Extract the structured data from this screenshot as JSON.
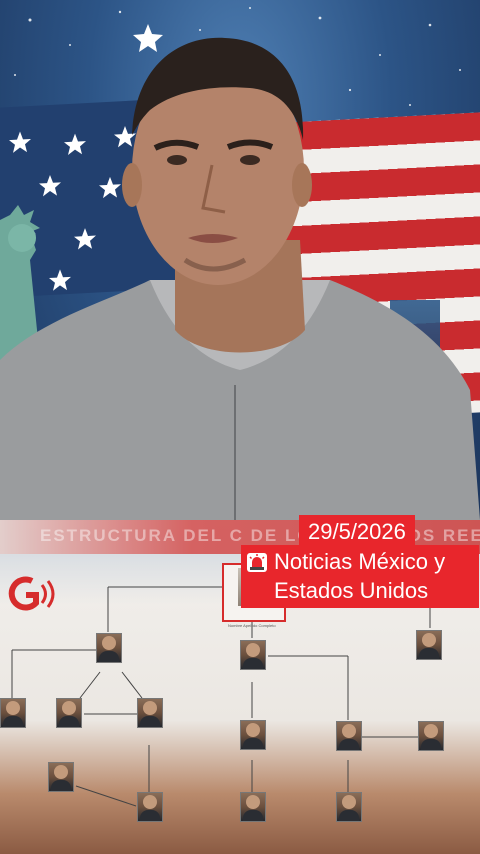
{
  "overlay": {
    "date": "29/5/2026",
    "headline_line1": "Noticias México y",
    "headline_line2": "Estados Unidos",
    "headline_icon": "siren-icon"
  },
  "chart": {
    "banner_text": "ESTRUCTURA DEL C   DE LOS CHAPITOS REES",
    "leader_caption": "Nombre Apellido Completo"
  },
  "colors": {
    "accent_red": "#e8262c",
    "flag_red": "#c92b2f",
    "sky_blue": "#2c5486"
  }
}
